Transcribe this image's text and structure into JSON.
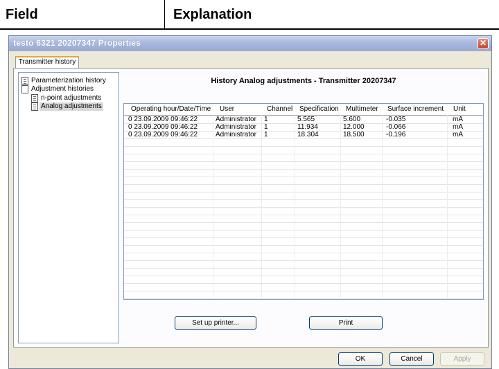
{
  "doc_header": {
    "field": "Field",
    "explanation": "Explanation"
  },
  "window": {
    "title": "testo 6321  20207347 Properties",
    "close_glyph": "✕"
  },
  "tab": {
    "label": "Transmitter history"
  },
  "tree": {
    "parameterization_history": "Parameterization history",
    "adjustment_histories": "Adjustment histories",
    "n_point_adjustments": "n-point adjustments",
    "analog_adjustments": "Analog adjustments"
  },
  "history_title": "History Analog adjustments - Transmitter 20207347",
  "grid": {
    "columns": [
      "Operating hour/Date/Time",
      "User",
      "Channel",
      "Specification",
      "Multimeter",
      "Surface increment",
      "Unit"
    ],
    "rows": [
      [
        "0 23.09.2009 09:46:22",
        "Administrator",
        "1",
        "5.565",
        "5.600",
        "-0.035",
        "mA"
      ],
      [
        "0 23.09.2009 09:46:22",
        "Administrator",
        "1",
        "11.934",
        "12.000",
        "-0.066",
        "mA"
      ],
      [
        "0 23.09.2009 09:46:22",
        "Administrator",
        "1",
        "18.304",
        "18.500",
        "-0.196",
        "mA"
      ]
    ]
  },
  "buttons": {
    "setup_printer": "Set up printer...",
    "print": "Print",
    "ok": "OK",
    "cancel": "Cancel",
    "apply": "Apply"
  }
}
